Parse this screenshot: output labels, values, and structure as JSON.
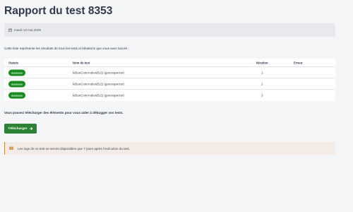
{
  "page": {
    "title": "Rapport du test 8353"
  },
  "date_bar": {
    "date": "mardi 13 mai 2025",
    "icon": "calendar-icon"
  },
  "intro": "Cette liste représente les résultats de tous les tests et itérations que vous avez lancés :",
  "table": {
    "headers": [
      "Statuts",
      "Nom du test",
      "Itération",
      "Erreur"
    ],
    "rows": [
      {
        "status": "success",
        "name": "leBonCoinAndroidS22 (greenspector)",
        "iteration": "1",
        "error": ""
      },
      {
        "status": "success",
        "name": "leBonCoinAndroidS22 (greenspector)",
        "iteration": "2",
        "error": ""
      },
      {
        "status": "success",
        "name": "leBonCoinAndroidS22 (greenspector)",
        "iteration": "3",
        "error": ""
      }
    ]
  },
  "download": {
    "text": "Vous pouvez télécharger des éléments pour vous aider à débugger vos tests.",
    "button_label": "Télécharger",
    "button_icon": "arrow-right-icon"
  },
  "notice": {
    "text": "Les logs de ce test ne seront disponibles que 7 jours après l'exécution du test.",
    "icon": "flag-icon"
  },
  "colors": {
    "success": "#178a20",
    "button": "#2b8233",
    "notice_accent": "#cd8a3c"
  }
}
